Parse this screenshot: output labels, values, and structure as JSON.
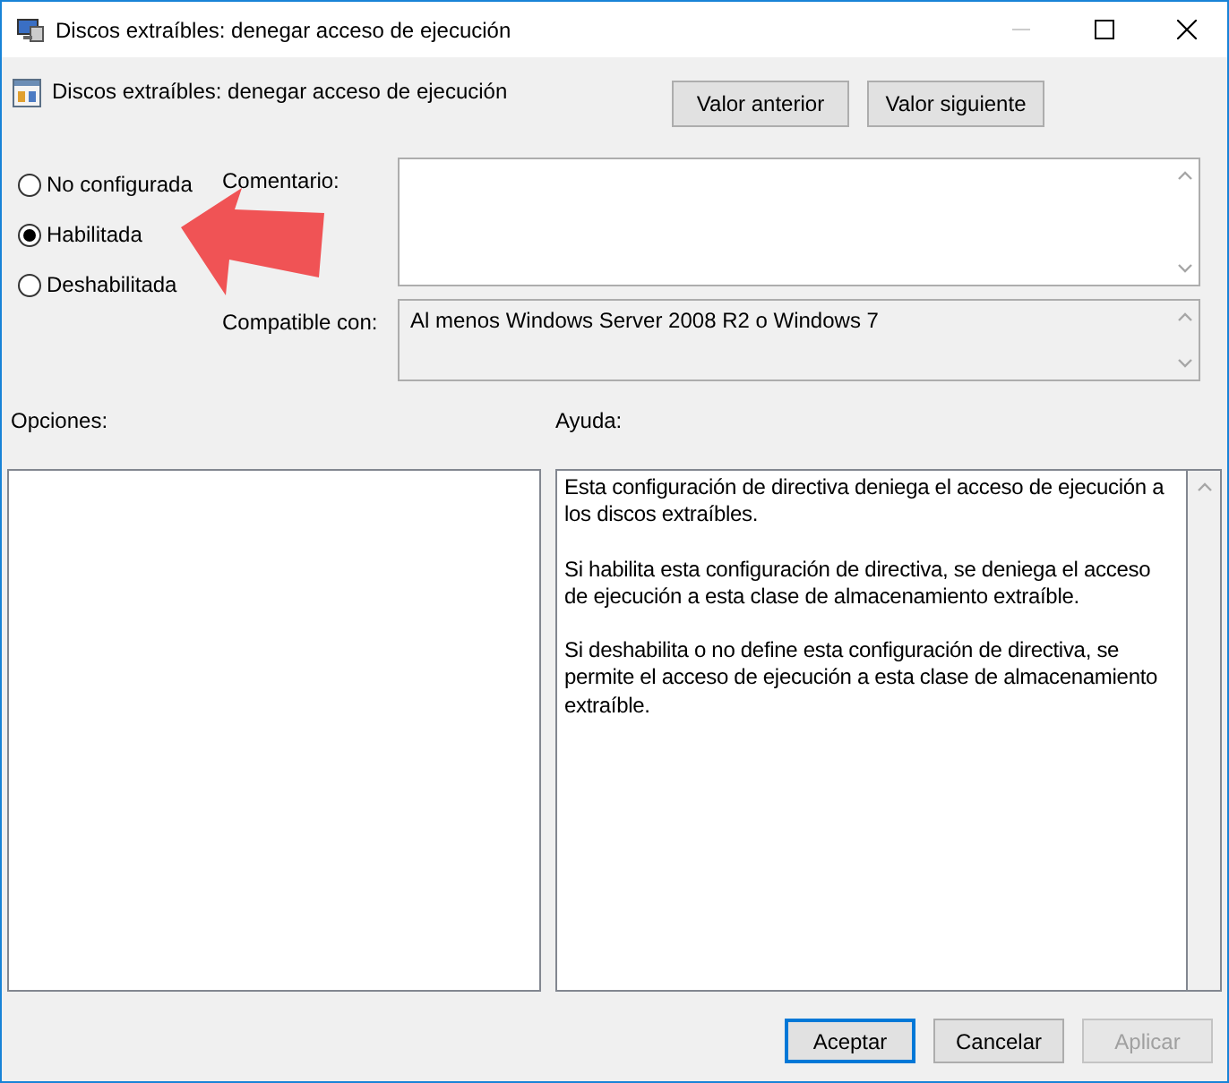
{
  "window": {
    "title": "Discos extraíbles: denegar acceso de ejecución"
  },
  "header": {
    "policy_name": "Discos extraíbles: denegar acceso de ejecución",
    "buttons": [
      {
        "label": "Valor anterior"
      },
      {
        "label": "Valor siguiente"
      }
    ]
  },
  "state_options": [
    {
      "label": "No configurada",
      "selected": false
    },
    {
      "label": "Habilitada",
      "selected": true
    },
    {
      "label": "Deshabilitada",
      "selected": false
    }
  ],
  "comment": {
    "label": "Comentario:"
  },
  "supported_on": {
    "label": "Compatible con:",
    "value": "Al menos Windows Server 2008 R2 o Windows 7"
  },
  "options": {
    "label": "Opciones:"
  },
  "help": {
    "label": "Ayuda:",
    "paragraphs": [
      "Esta configuración de directiva deniega el acceso de ejecución a los discos extraíbles.",
      "Si habilita esta configuración de directiva, se deniega el acceso de ejecución a esta clase de almacenamiento extraíble.",
      "Si deshabilita o no define esta configuración de directiva, se permite el acceso de ejecución a esta clase de almacenamiento extraíble."
    ]
  },
  "buttons": [
    {
      "label": "Aceptar",
      "focused": true,
      "disabled": false
    },
    {
      "label": "Cancelar",
      "focused": false,
      "disabled": false
    },
    {
      "label": "Aplicar",
      "focused": false,
      "disabled": true
    }
  ]
}
